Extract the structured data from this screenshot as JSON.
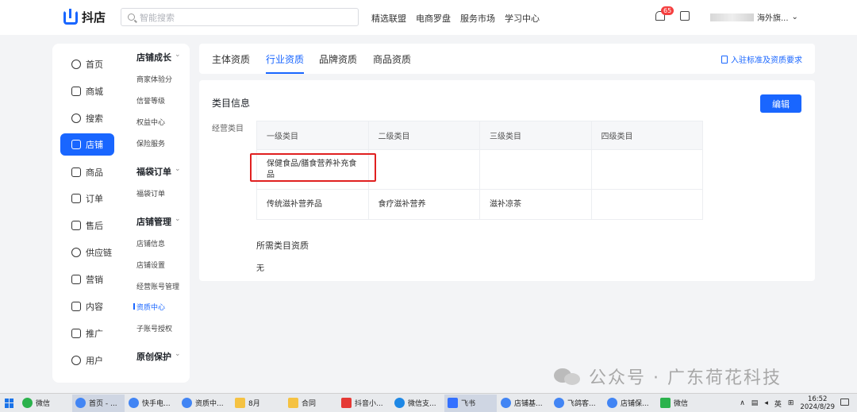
{
  "app": {
    "name": "抖店"
  },
  "search": {
    "placeholder": "智能搜索"
  },
  "topnav": [
    "精选联盟",
    "电商罗盘",
    "服务市场",
    "学习中心"
  ],
  "notifications": {
    "count": "65"
  },
  "user": {
    "name": "海外旗..."
  },
  "sidebar": {
    "items": [
      {
        "label": "首页",
        "icon": "home-icon"
      },
      {
        "label": "商城",
        "icon": "mall-icon"
      },
      {
        "label": "搜索",
        "icon": "search-icon"
      },
      {
        "label": "店铺",
        "icon": "store-icon",
        "active": true
      },
      {
        "label": "商品",
        "icon": "product-icon"
      },
      {
        "label": "订单",
        "icon": "order-icon"
      },
      {
        "label": "售后",
        "icon": "aftersale-icon"
      },
      {
        "label": "供应链",
        "icon": "supply-chain-icon"
      },
      {
        "label": "营销",
        "icon": "marketing-icon"
      },
      {
        "label": "内容",
        "icon": "content-icon"
      },
      {
        "label": "推广",
        "icon": "promotion-icon"
      },
      {
        "label": "用户",
        "icon": "user-icon"
      }
    ]
  },
  "subnav": {
    "g1_title": "店铺成长",
    "g1_items": [
      "商家体验分",
      "信誉等级",
      "权益中心",
      "保险服务"
    ],
    "g2_title": "福袋订单",
    "g2_items": [
      "福袋订单"
    ],
    "g3_title": "店铺管理",
    "g3_items": [
      "店铺信息",
      "店铺设置",
      "经营账号管理",
      "资质中心",
      "子账号授权"
    ],
    "g4_title": "原创保护"
  },
  "tabs": [
    "主体资质",
    "行业资质",
    "品牌资质",
    "商品资质"
  ],
  "tabs_link": "入驻标准及资质要求",
  "main": {
    "section_title": "类目信息",
    "edit_label": "编辑",
    "field_label": "经营类目",
    "table": {
      "headers": [
        "一级类目",
        "二级类目",
        "三级类目",
        "四级类目"
      ],
      "rows": [
        [
          "保健食品/膳食营养补充食品",
          "",
          "",
          ""
        ],
        [
          "传统滋补营养品",
          "食疗滋补营养",
          "滋补凉茶",
          ""
        ]
      ]
    },
    "required_title": "所需类目资质",
    "required_value": "无"
  },
  "watermark": "公众号 · 广东荷花科技",
  "taskbar": {
    "items": [
      "微信",
      "首页 - ...",
      "快手电...",
      "资质中...",
      "8月",
      "合同",
      "抖音小...",
      "微信支...",
      "飞书",
      "店铺基...",
      "飞鸽客...",
      "店铺保...",
      "微信"
    ],
    "ime": "英",
    "time": "16:52",
    "date": "2024/8/29"
  },
  "colors": {
    "accent": "#1966ff",
    "highlight_box": "#e02020",
    "badge": "#f53f3f"
  }
}
